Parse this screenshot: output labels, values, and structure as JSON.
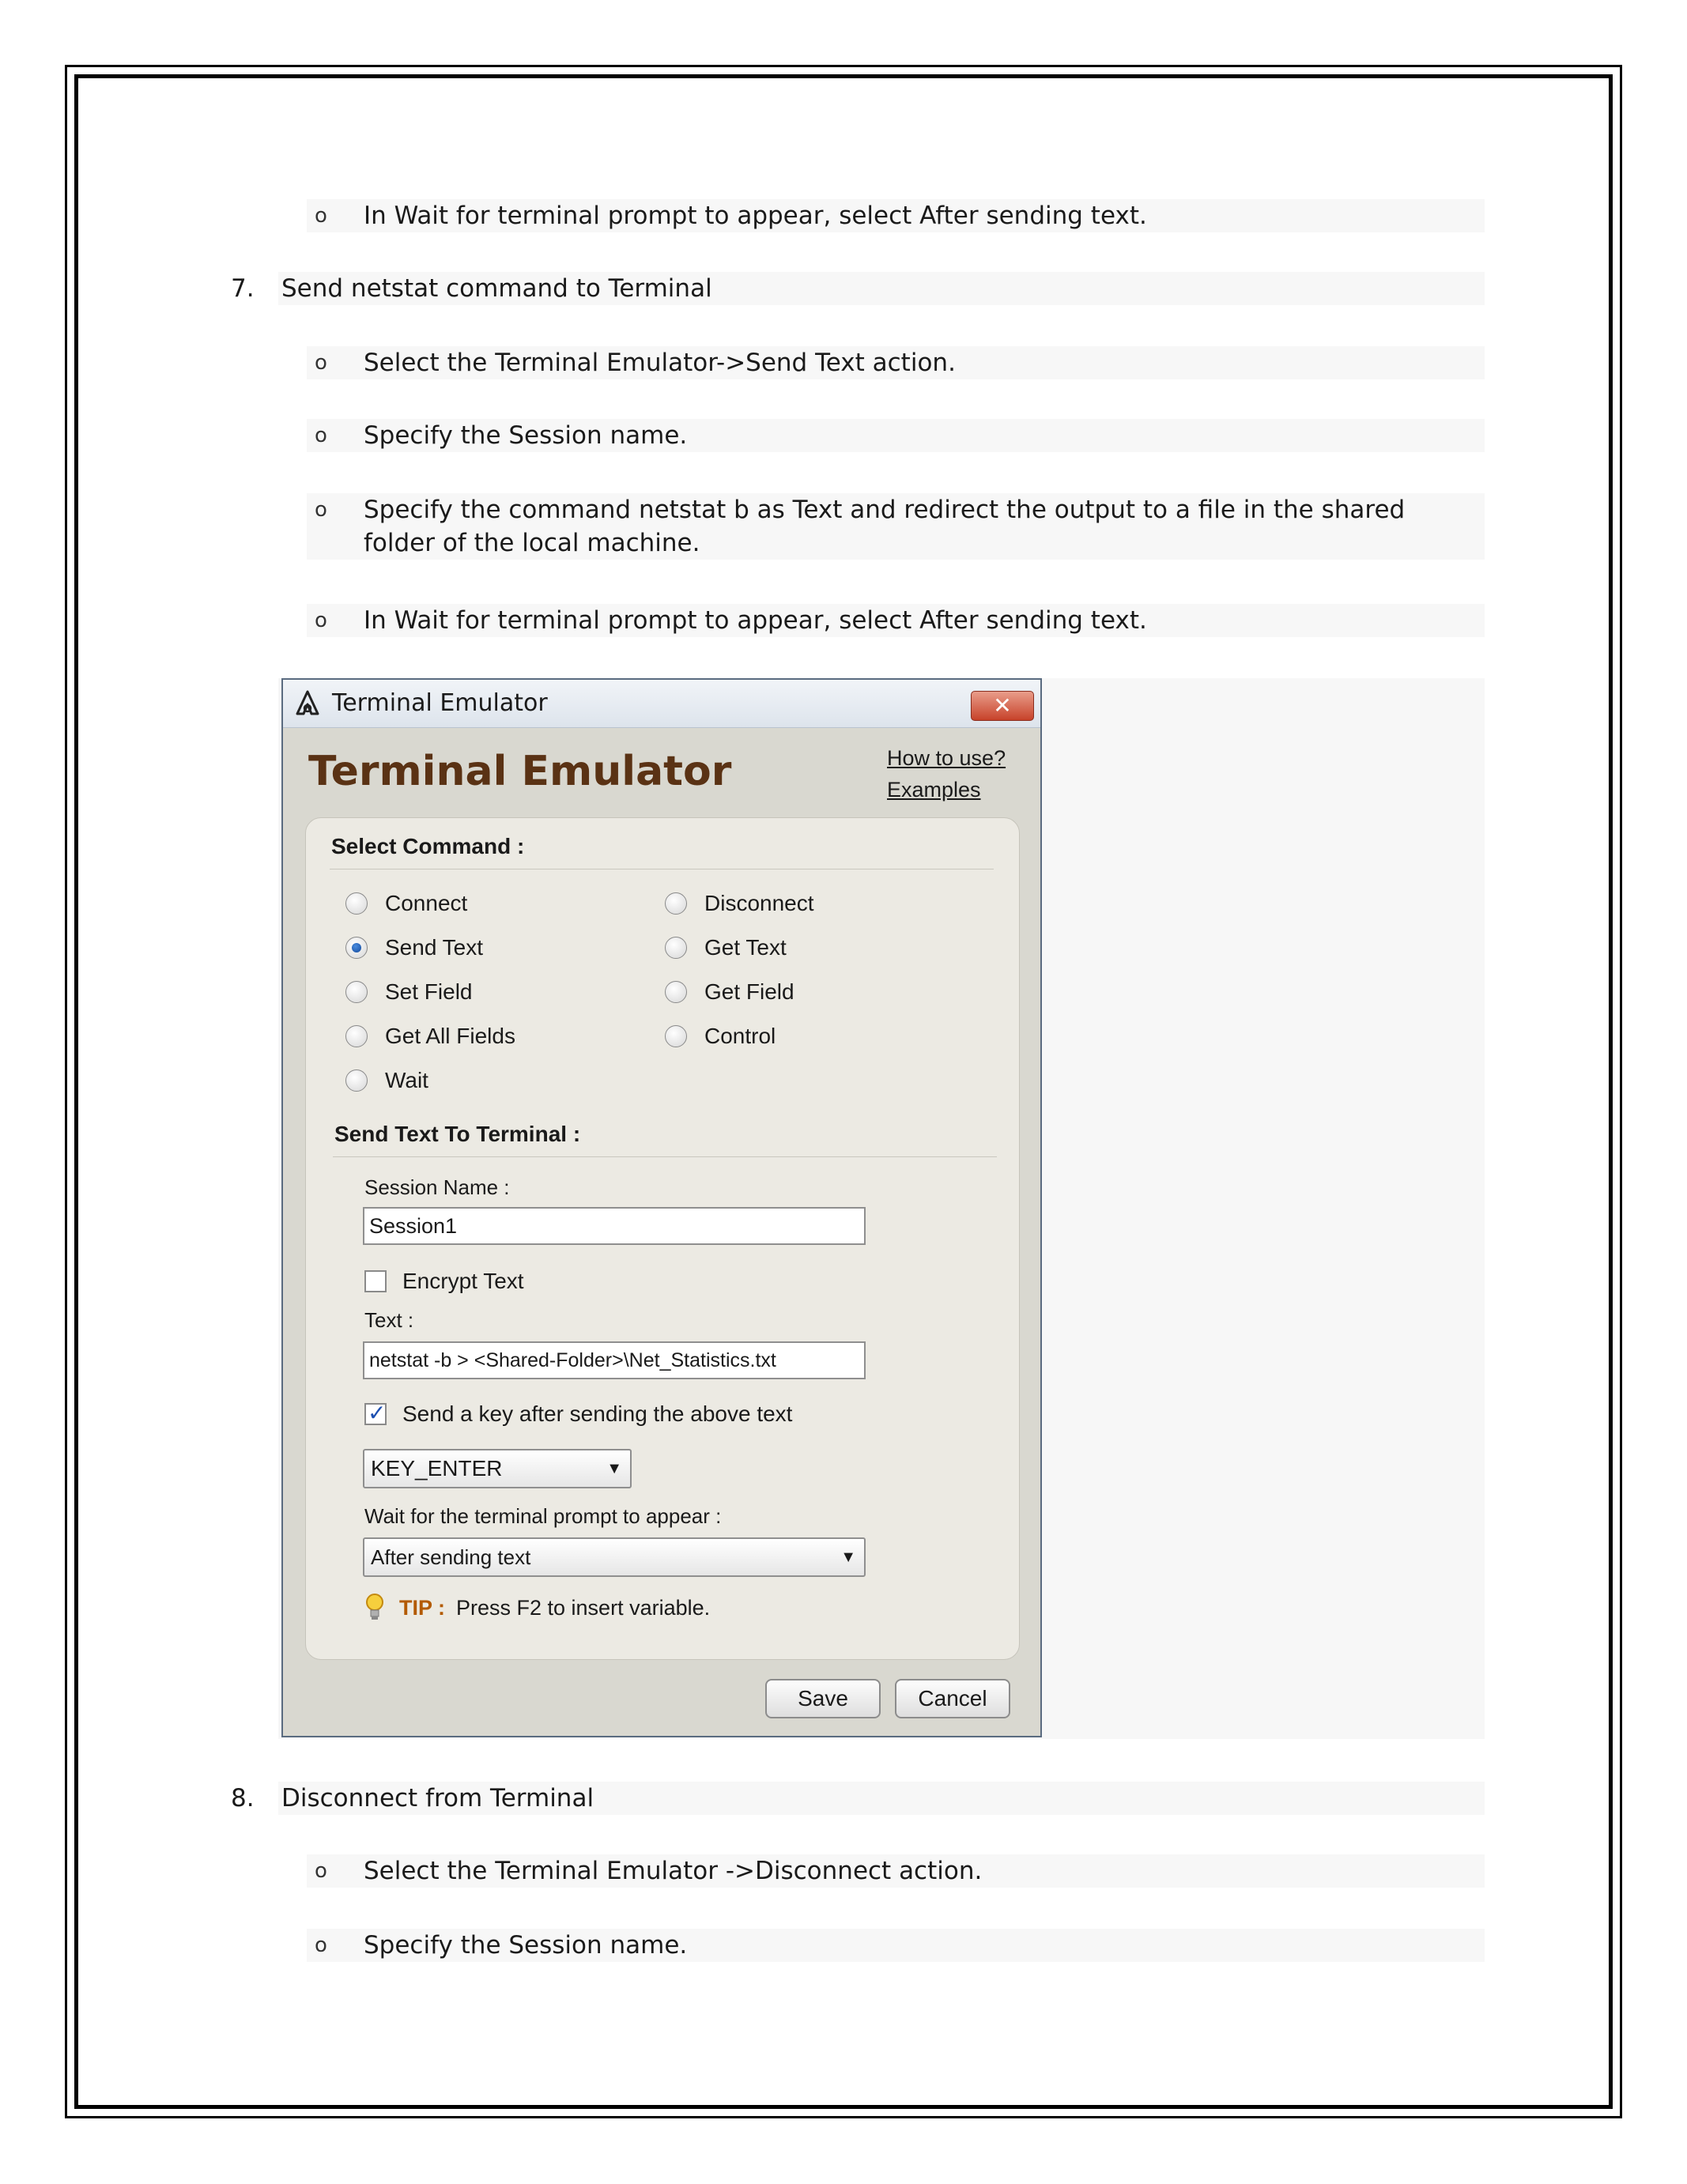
{
  "doc": {
    "lines": [
      {
        "text": "In Wait for terminal prompt to appear, select After sending text."
      },
      {
        "number": "7.",
        "text": "Send netstat command to Terminal"
      },
      {
        "text": "Select the Terminal Emulator->Send Text action."
      },
      {
        "text": "Specify the Session name."
      },
      {
        "text": "Specify the command netstat b as Text and redirect the output to a file in the shared folder of the local machine."
      },
      {
        "text": "In Wait for terminal prompt to appear, select After sending text."
      },
      {
        "number": "8.",
        "text": "Disconnect from Terminal"
      },
      {
        "text": "Select the Terminal Emulator ->Disconnect action."
      },
      {
        "text": "Specify the Session name."
      }
    ],
    "bullet_glyph": "o"
  },
  "dialog": {
    "window_title": "Terminal Emulator",
    "close_glyph": "✕",
    "header_title": "Terminal Emulator",
    "links": {
      "how_to_use": "How to use?",
      "examples": "Examples"
    },
    "select_command_title": "Select Command :",
    "commands": [
      {
        "label": "Connect",
        "checked": false
      },
      {
        "label": "Disconnect",
        "checked": false
      },
      {
        "label": "Send Text",
        "checked": true
      },
      {
        "label": "Get Text",
        "checked": false
      },
      {
        "label": "Set Field",
        "checked": false
      },
      {
        "label": "Get Field",
        "checked": false
      },
      {
        "label": "Get All Fields",
        "checked": false
      },
      {
        "label": "Control",
        "checked": false
      },
      {
        "label": "Wait",
        "checked": false
      }
    ],
    "send_text_title": "Send Text To Terminal :",
    "session_label": "Session Name :",
    "session_value": "Session1",
    "encrypt_label": "Encrypt Text",
    "encrypt_checked": false,
    "text_label": "Text :",
    "text_value": "netstat -b > <Shared-Folder>\\Net_Statistics.txt",
    "send_key_label": "Send a key after sending the above text",
    "send_key_checked": true,
    "key_value": "KEY_ENTER",
    "wait_label": "Wait for the terminal prompt to appear :",
    "wait_value": "After sending text",
    "tip_label": "TIP :",
    "tip_text": "Press F2 to insert variable.",
    "save_label": "Save",
    "cancel_label": "Cancel",
    "icons": [
      "automation-anywhere-logo-icon",
      "close-icon",
      "radio-icon",
      "checkbox-icon",
      "dropdown-arrow-icon",
      "lightbulb-icon"
    ]
  }
}
